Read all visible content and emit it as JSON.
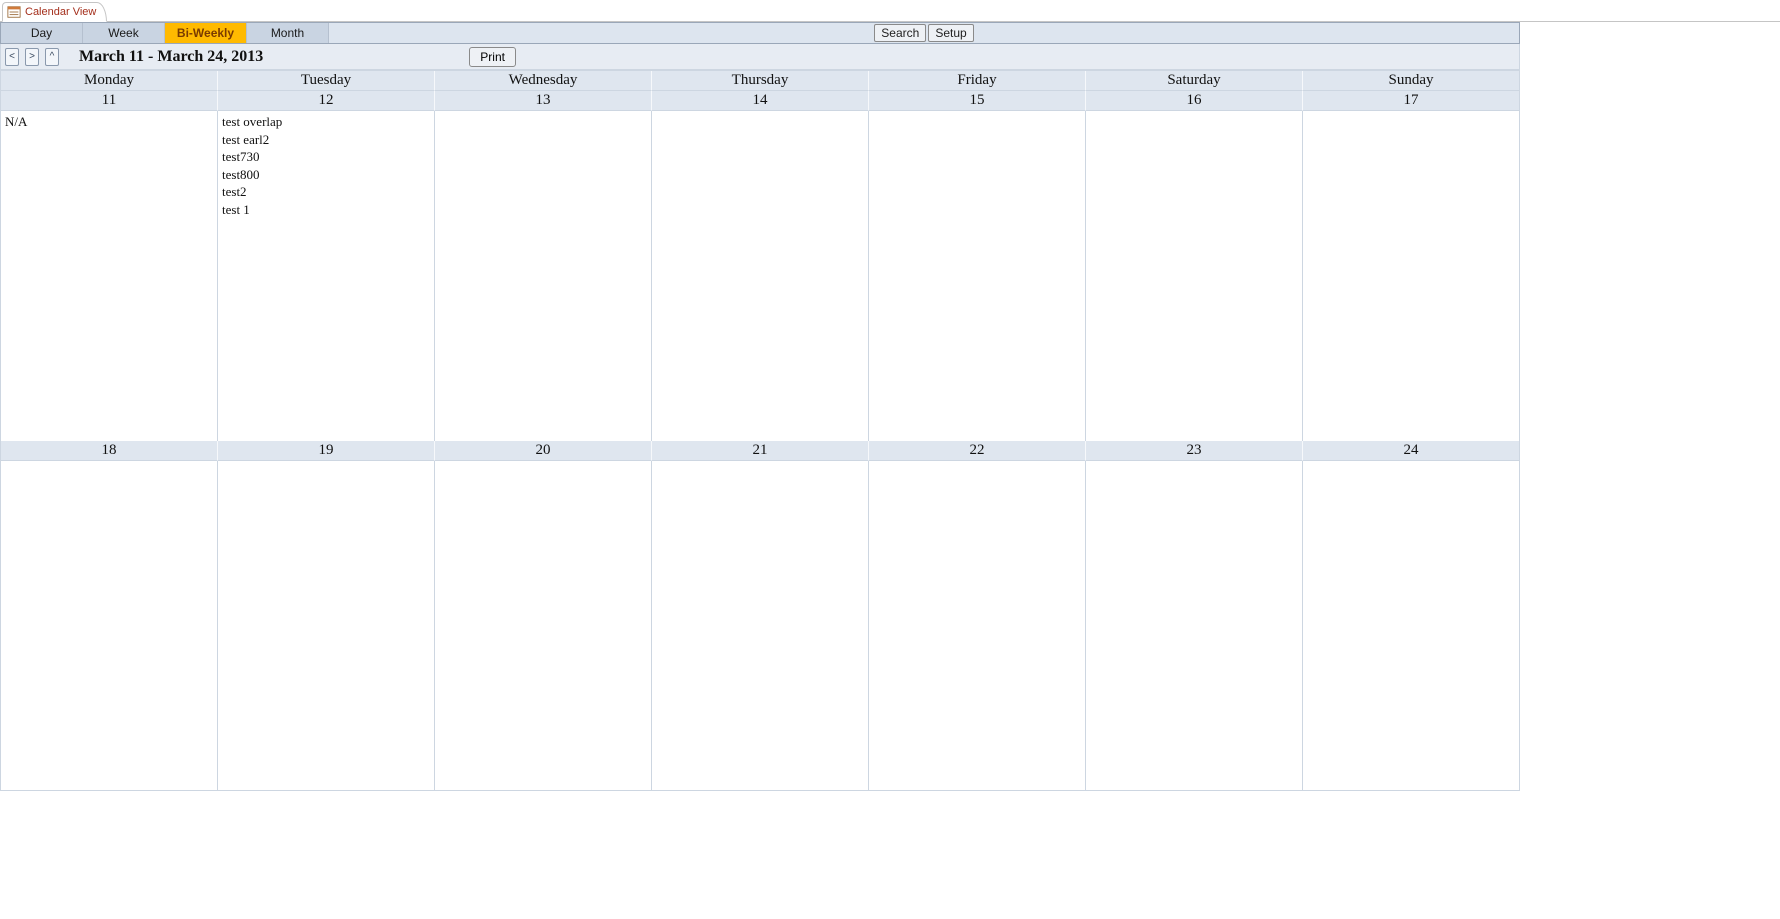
{
  "tab": {
    "title": "Calendar View"
  },
  "viewTabs": {
    "items": [
      "Day",
      "Week",
      "Bi-Weekly",
      "Month"
    ],
    "activeIndex": 2
  },
  "toolbar": {
    "search": "Search",
    "setup": "Setup",
    "print": "Print"
  },
  "nav": {
    "prev": "<",
    "next": ">",
    "up": "^",
    "rangeTitle": "March 11 - March 24, 2013"
  },
  "dayNames": [
    "Monday",
    "Tuesday",
    "Wednesday",
    "Thursday",
    "Friday",
    "Saturday",
    "Sunday"
  ],
  "weeks": [
    {
      "dates": [
        "11",
        "12",
        "13",
        "14",
        "15",
        "16",
        "17"
      ],
      "cells": [
        [
          "N/A"
        ],
        [
          "test overlap",
          "test earl2",
          "test730",
          "test800",
          "test2",
          "test 1"
        ],
        [],
        [],
        [],
        [],
        []
      ]
    },
    {
      "dates": [
        "18",
        "19",
        "20",
        "21",
        "22",
        "23",
        "24"
      ],
      "cells": [
        [],
        [],
        [],
        [],
        [],
        [],
        []
      ]
    }
  ]
}
